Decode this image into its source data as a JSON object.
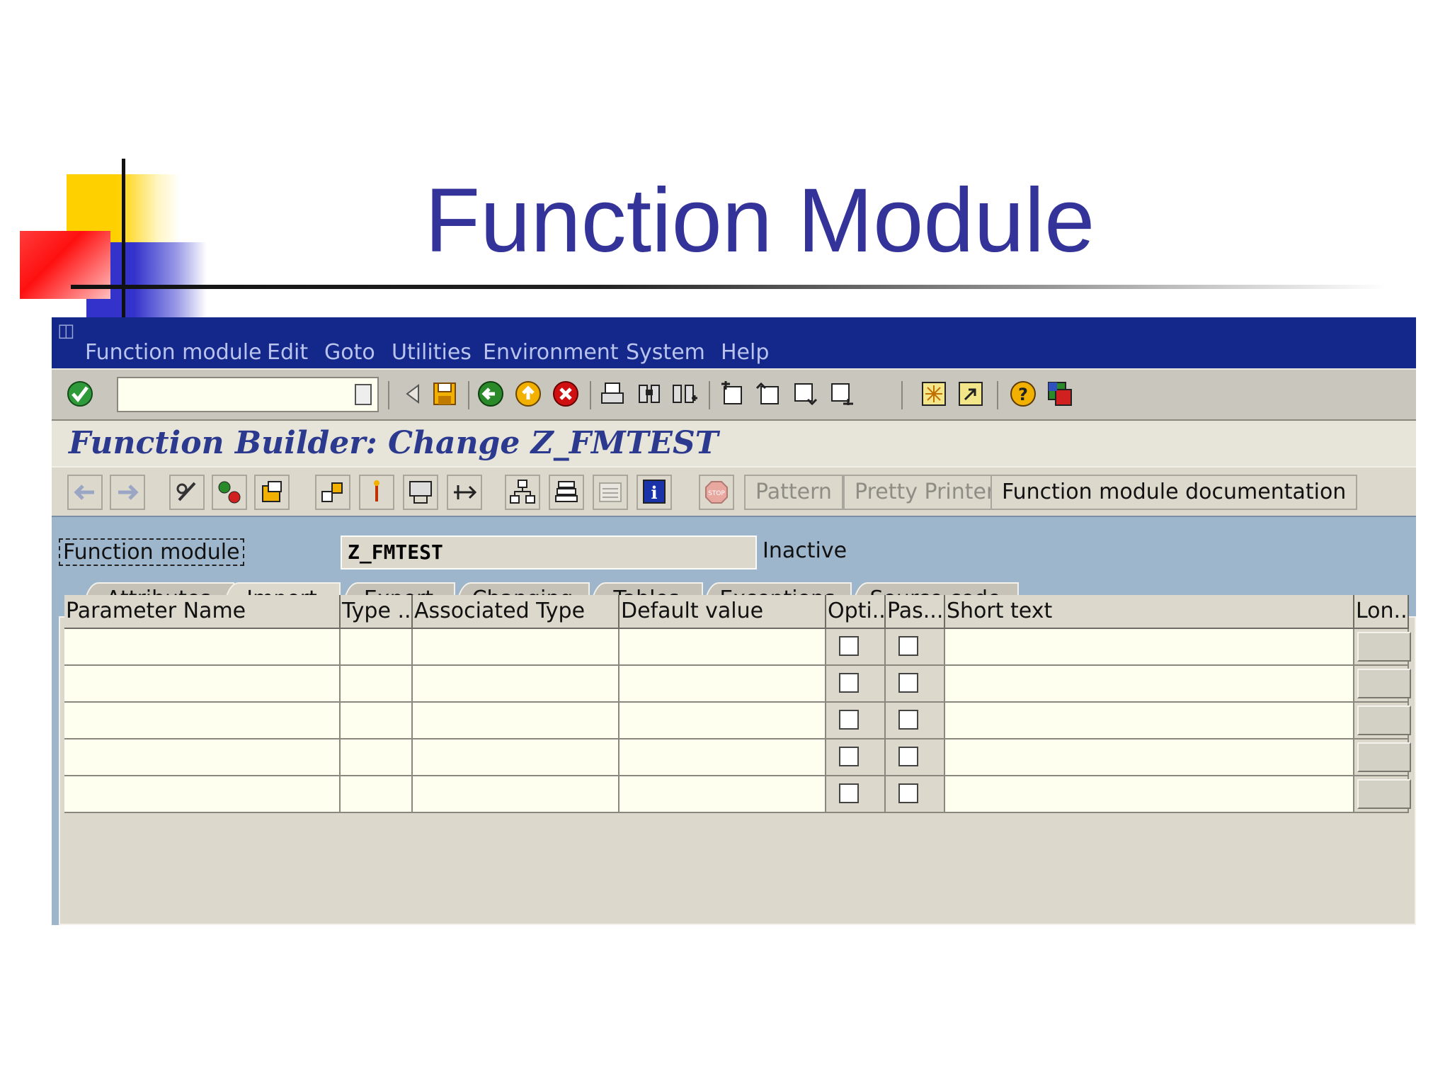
{
  "slide": {
    "title": "Function Module"
  },
  "menubar": {
    "items": [
      "Function module",
      "Edit",
      "Goto",
      "Utilities",
      "Environment",
      "System",
      "Help"
    ]
  },
  "standard_toolbar": {
    "command_field_value": "",
    "icons": [
      "enter-icon",
      "back-icon",
      "save-icon",
      "back-circle-icon",
      "exit-icon",
      "cancel-icon",
      "print-icon",
      "find-icon",
      "find-next-icon",
      "first-page-icon",
      "previous-page-icon",
      "next-page-icon",
      "last-page-icon",
      "create-session-icon",
      "shortcut-icon",
      "help-icon",
      "layout-icon"
    ]
  },
  "screen": {
    "title": "Function Builder: Change Z_FMTEST"
  },
  "app_toolbar": {
    "buttons": {
      "pattern": "Pattern",
      "pretty_printer": "Pretty Printer",
      "documentation": "Function module documentation"
    }
  },
  "header_fields": {
    "label": "Function module",
    "value": "Z_FMTEST",
    "status": "Inactive"
  },
  "tabs": [
    {
      "label": "Attributes",
      "active": false
    },
    {
      "label": "Import",
      "active": true
    },
    {
      "label": "Export",
      "active": false
    },
    {
      "label": "Changing",
      "active": false
    },
    {
      "label": "Tables",
      "active": false
    },
    {
      "label": "Exceptions",
      "active": false
    },
    {
      "label": "Source code",
      "active": false
    }
  ],
  "table": {
    "columns": [
      "Parameter Name",
      "Type ...",
      "Associated Type",
      "Default value",
      "Opti...",
      "Pas...",
      "Short text",
      "Lon..."
    ],
    "rows": [
      {
        "parameter_name": "",
        "type": "",
        "associated_type": "",
        "default_value": "",
        "optional": false,
        "pass_value": false,
        "short_text": ""
      },
      {
        "parameter_name": "",
        "type": "",
        "associated_type": "",
        "default_value": "",
        "optional": false,
        "pass_value": false,
        "short_text": ""
      },
      {
        "parameter_name": "",
        "type": "",
        "associated_type": "",
        "default_value": "",
        "optional": false,
        "pass_value": false,
        "short_text": ""
      },
      {
        "parameter_name": "",
        "type": "",
        "associated_type": "",
        "default_value": "",
        "optional": false,
        "pass_value": false,
        "short_text": ""
      },
      {
        "parameter_name": "",
        "type": "",
        "associated_type": "",
        "default_value": "",
        "optional": false,
        "pass_value": false,
        "short_text": ""
      }
    ]
  },
  "colors": {
    "slide_title": "#33339a",
    "menubar": "#13288a",
    "screen_title": "#2b3a8f",
    "work_area": "#9eb6cc",
    "input_cell": "#fffff0"
  }
}
